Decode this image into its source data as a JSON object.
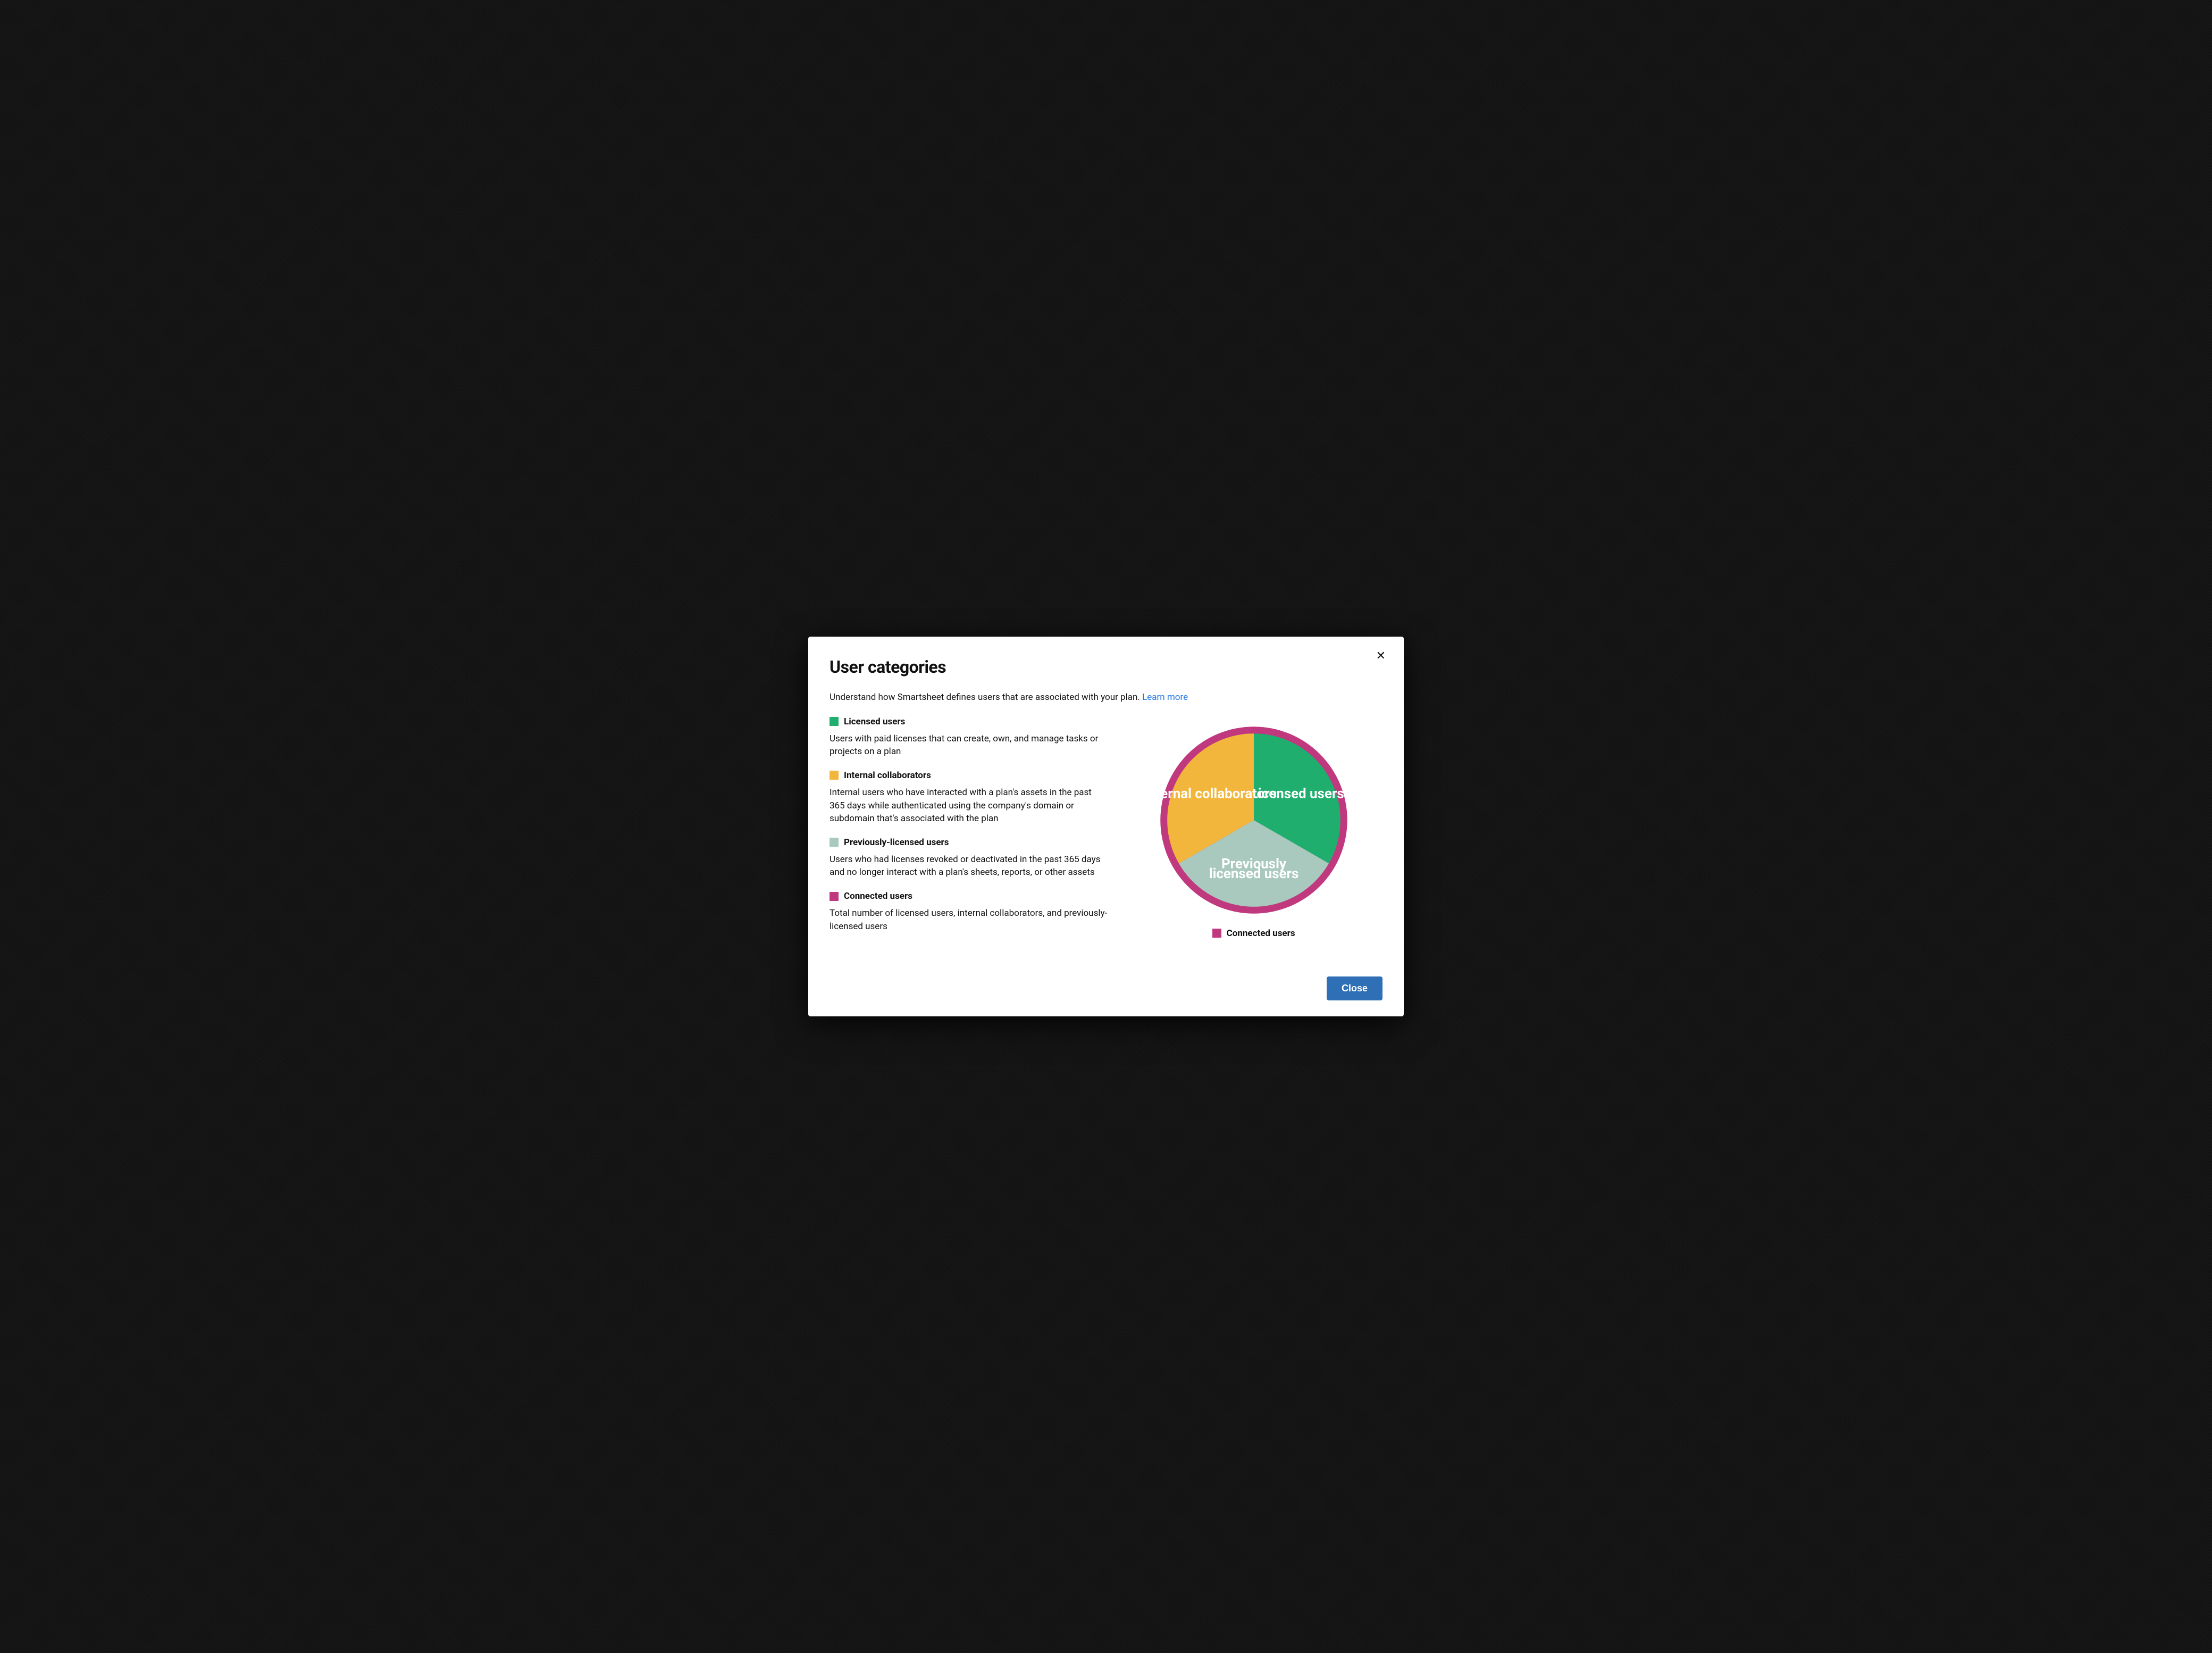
{
  "modal": {
    "title": "User categories",
    "intro_text": "Understand how Smartsheet defines users that are associated with your plan. ",
    "learn_more": "Learn more",
    "close_button": "Close"
  },
  "categories": [
    {
      "key": "licensed",
      "title": "Licensed users",
      "desc": "Users with paid licenses that can create, own, and manage tasks or projects on a plan",
      "color": "#1fae6e"
    },
    {
      "key": "internal",
      "title": "Internal collaborators",
      "desc": "Internal users who have interacted with a plan's assets in the past 365 days while authenticated using the company's domain or subdomain that's associated with the plan",
      "color": "#f2b63c"
    },
    {
      "key": "previously",
      "title": "Previously-licensed users",
      "desc": "Users who had licenses revoked or deactivated in the past 365 days and no longer interact with a plan's sheets, reports, or other assets",
      "color": "#a9c9bf"
    },
    {
      "key": "connected",
      "title": "Connected users",
      "desc": "Total number of licensed users, internal collaborators, and previously-licensed users",
      "color": "#c0397f"
    }
  ],
  "chart_data": {
    "type": "pie",
    "title": "",
    "ring_color": "#c0397f",
    "series": [
      {
        "name": "Licensed users",
        "value": 33.33,
        "color": "#1fae6e",
        "label_lines": [
          "Licensed users"
        ]
      },
      {
        "name": "Previously licensed users",
        "value": 33.33,
        "color": "#a9c9bf",
        "label_lines": [
          "Previously",
          "licensed users"
        ]
      },
      {
        "name": "Internal collaborators",
        "value": 33.33,
        "color": "#f2b63c",
        "label_lines": [
          "Internal collaborators"
        ]
      }
    ],
    "legend_below": "Connected users",
    "legend_below_color": "#c0397f"
  }
}
